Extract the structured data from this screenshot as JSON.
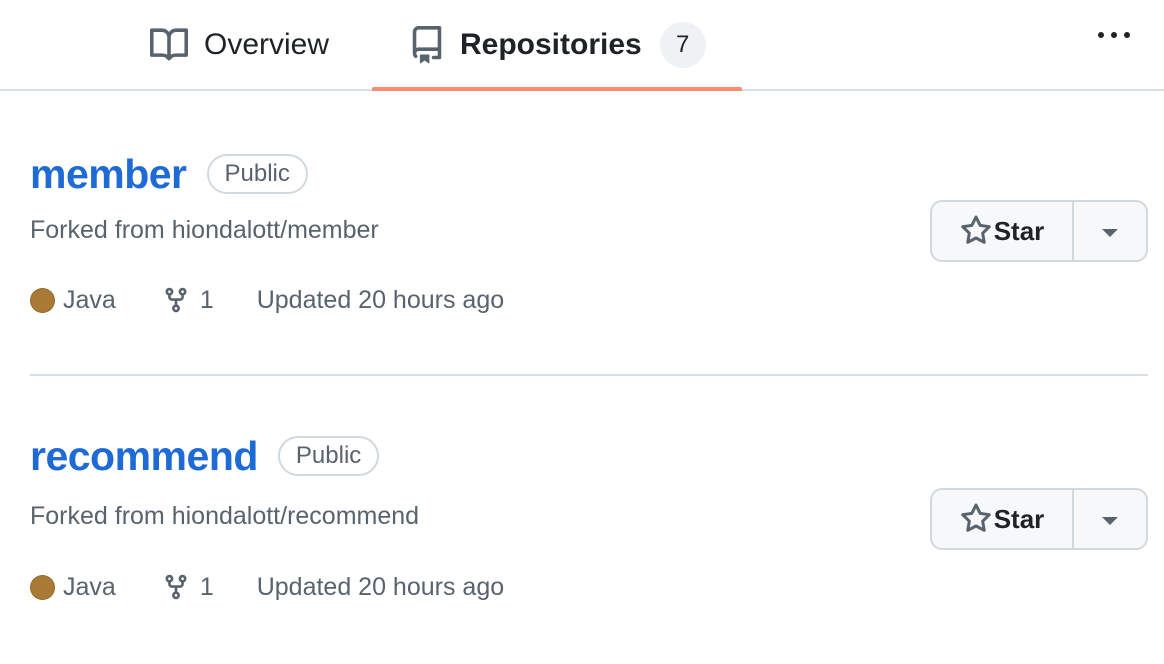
{
  "nav": {
    "tabs": [
      {
        "label": "Overview",
        "icon": "book-icon",
        "selected": false
      },
      {
        "label": "Repositories",
        "icon": "repo-icon",
        "counter": "7",
        "selected": true
      }
    ],
    "more_icon": "kebab-horizontal-icon"
  },
  "repos": [
    {
      "name": "member",
      "visibility": "Public",
      "forked_from_prefix": "Forked from ",
      "forked_from": "hiondalott/member",
      "language": "Java",
      "language_color": "#a87a35",
      "forks": "1",
      "updated": "Updated 20 hours ago",
      "star_label": "Star"
    },
    {
      "name": "recommend",
      "visibility": "Public",
      "forked_from_prefix": "Forked from ",
      "forked_from": "hiondalott/recommend",
      "language": "Java",
      "language_color": "#a87a35",
      "forks": "1",
      "updated": "Updated 20 hours ago",
      "star_label": "Star"
    }
  ],
  "colors": {
    "link": "#1f6bd6",
    "selected_underline": "#fd8c73",
    "muted": "#59636e",
    "border": "#d1d9e0"
  }
}
